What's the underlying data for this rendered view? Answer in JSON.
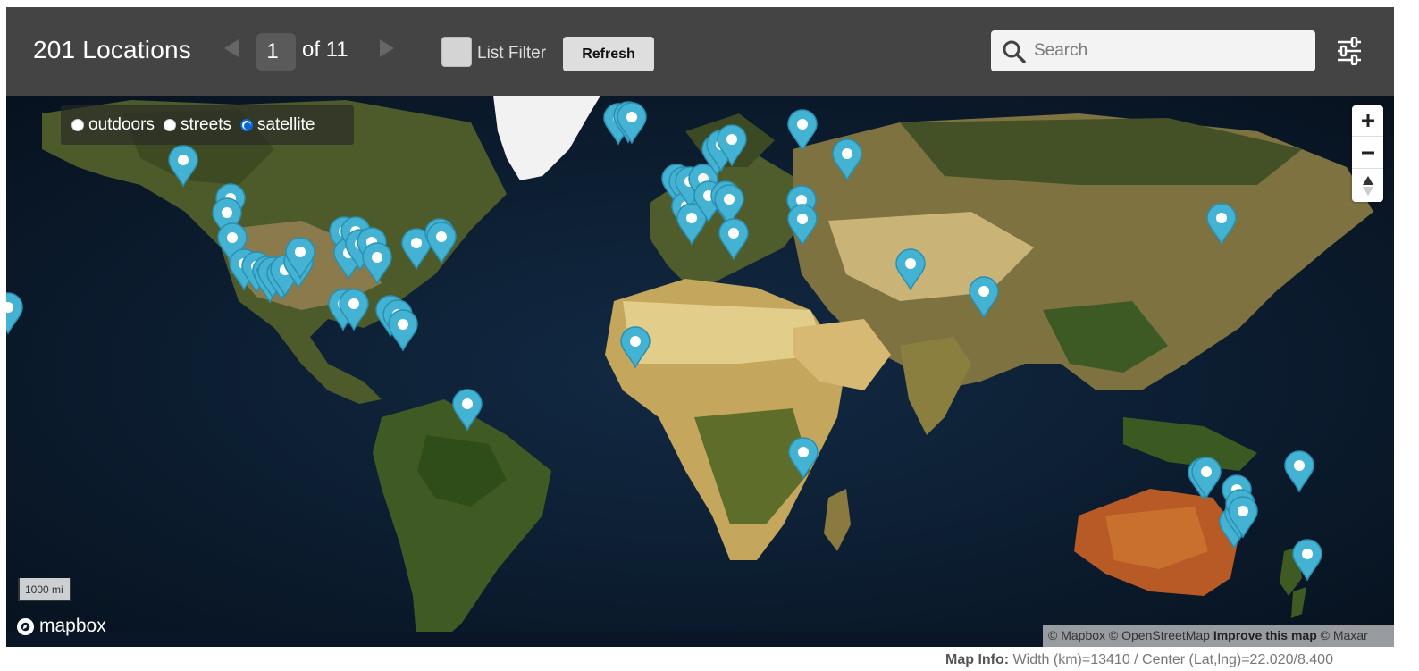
{
  "header": {
    "location_count": "201 Locations",
    "page_current": "1",
    "page_of": "of 11",
    "list_filter_label": "List Filter",
    "refresh_label": "Refresh",
    "search_placeholder": "Search",
    "prev_icon": "triangle-left-icon",
    "next_icon": "triangle-right-icon",
    "filters_icon": "sliders-icon"
  },
  "map": {
    "styles": [
      {
        "label": "outdoors",
        "selected": false
      },
      {
        "label": "streets",
        "selected": false
      },
      {
        "label": "satellite",
        "selected": true
      }
    ],
    "zoom_in_label": "+",
    "zoom_out_label": "−",
    "scale_label": "1000 mi",
    "logo_text": "mapbox",
    "attribution": {
      "mapbox": "© Mapbox",
      "osm": "© OpenStreetMap",
      "improve": "Improve this map",
      "maxar": "© Maxar"
    },
    "pin_color": "#44b3d3",
    "pins": [
      {
        "lng": -179.5,
        "lat": 22.9
      },
      {
        "lng": -134,
        "lat": 57.3
      },
      {
        "lng": -121.9,
        "lat": 48.3
      },
      {
        "lng": -122.7,
        "lat": 44.9
      },
      {
        "lng": -121.3,
        "lat": 39.2
      },
      {
        "lng": -118.3,
        "lat": 33.1
      },
      {
        "lng": -115.2,
        "lat": 32.4
      },
      {
        "lng": -112.4,
        "lat": 31.4
      },
      {
        "lng": -111.7,
        "lat": 30.2
      },
      {
        "lng": -110.9,
        "lat": 31.1
      },
      {
        "lng": -108.5,
        "lat": 30.7
      },
      {
        "lng": -107.7,
        "lat": 31.5
      },
      {
        "lng": -104.1,
        "lat": 33.4
      },
      {
        "lng": -103.7,
        "lat": 35.7
      },
      {
        "lng": -92.7,
        "lat": 23.6
      },
      {
        "lng": -89.8,
        "lat": 23.6
      },
      {
        "lng": -92.3,
        "lat": 40.6
      },
      {
        "lng": -91.2,
        "lat": 35.6
      },
      {
        "lng": -89.3,
        "lat": 40.5
      },
      {
        "lng": -88.3,
        "lat": 37.6
      },
      {
        "lng": -85.3,
        "lat": 38.0
      },
      {
        "lng": -83.8,
        "lat": 34.6
      },
      {
        "lng": -80.4,
        "lat": 22.1
      },
      {
        "lng": -78.5,
        "lat": 21.2
      },
      {
        "lng": -77.1,
        "lat": 18.8
      },
      {
        "lng": -73.5,
        "lat": 37.8
      },
      {
        "lng": -67.6,
        "lat": 40.1
      },
      {
        "lng": -67.2,
        "lat": 39.4
      },
      {
        "lng": -60.3,
        "lat": 0.2
      },
      {
        "lng": -21.3,
        "lat": 67.2
      },
      {
        "lng": -18.6,
        "lat": 67.6
      },
      {
        "lng": -17.8,
        "lat": 67.3
      },
      {
        "lng": -16.9,
        "lat": 14.8
      },
      {
        "lng": -6.2,
        "lat": 52.9
      },
      {
        "lng": -4.4,
        "lat": 52.2
      },
      {
        "lng": -3.6,
        "lat": 46.4
      },
      {
        "lng": -2.7,
        "lat": 52.2
      },
      {
        "lng": -2.3,
        "lat": 43.7
      },
      {
        "lng": 0.7,
        "lat": 52.9
      },
      {
        "lng": 2.2,
        "lat": 48.9
      },
      {
        "lng": 4.4,
        "lat": 59.8
      },
      {
        "lng": 5.4,
        "lat": 60.8
      },
      {
        "lng": 6.6,
        "lat": 48.9
      },
      {
        "lng": 7.5,
        "lat": 48.1
      },
      {
        "lng": 8.3,
        "lat": 62.2
      },
      {
        "lng": 8.6,
        "lat": 40.1
      },
      {
        "lng": 26.4,
        "lat": 47.8
      },
      {
        "lng": 26.6,
        "lat": 43.5
      },
      {
        "lng": 26.6,
        "lat": 65.6
      },
      {
        "lng": 38.1,
        "lat": 58.8
      },
      {
        "lng": 26.7,
        "lat": -11.0
      },
      {
        "lng": 54.7,
        "lat": 33.1
      },
      {
        "lng": 73.5,
        "lat": 26.5
      },
      {
        "lng": 135.3,
        "lat": 43.7
      },
      {
        "lng": 130.3,
        "lat": -15.9
      },
      {
        "lng": 131.3,
        "lat": -15.6
      },
      {
        "lng": 139.2,
        "lat": -19.9
      },
      {
        "lng": 138.5,
        "lat": -27.3
      },
      {
        "lng": 139.8,
        "lat": -25.2
      },
      {
        "lng": 140.2,
        "lat": -23.2
      },
      {
        "lng": 140.8,
        "lat": -24.8
      },
      {
        "lng": 155.4,
        "lat": -14.3
      },
      {
        "lng": 157.6,
        "lat": -34.9
      }
    ]
  },
  "footer": {
    "label": "Map Info:",
    "value": "Width (km)=13410 / Center (Lat,lng)=22.020/8.400"
  },
  "colors": {
    "header_bg": "#444444",
    "ocean": "#0b1a2c",
    "pin": "#44b3d3"
  }
}
